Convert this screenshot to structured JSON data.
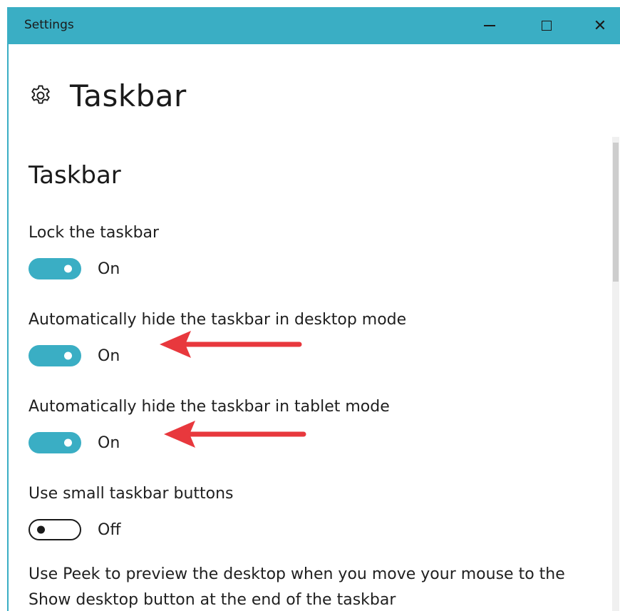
{
  "window": {
    "title": "Settings",
    "controls": {
      "minimize": "minimize",
      "maximize": "maximize",
      "close": "✕"
    }
  },
  "header": {
    "icon": "gear-icon",
    "title": "Taskbar"
  },
  "section": {
    "title": "Taskbar"
  },
  "settings": [
    {
      "label": "Lock the taskbar",
      "state": "On",
      "enabled": true
    },
    {
      "label": "Automatically hide the taskbar in desktop mode",
      "state": "On",
      "enabled": true
    },
    {
      "label": "Automatically hide the taskbar in tablet mode",
      "state": "On",
      "enabled": true
    },
    {
      "label": "Use small taskbar buttons",
      "state": "Off",
      "enabled": false
    }
  ],
  "peek": {
    "text": "Use Peek to preview the desktop when you move your mouse to the Show desktop button at the end of the taskbar"
  },
  "colors": {
    "accent": "#3aaec4",
    "annotation": "#e8383d"
  }
}
